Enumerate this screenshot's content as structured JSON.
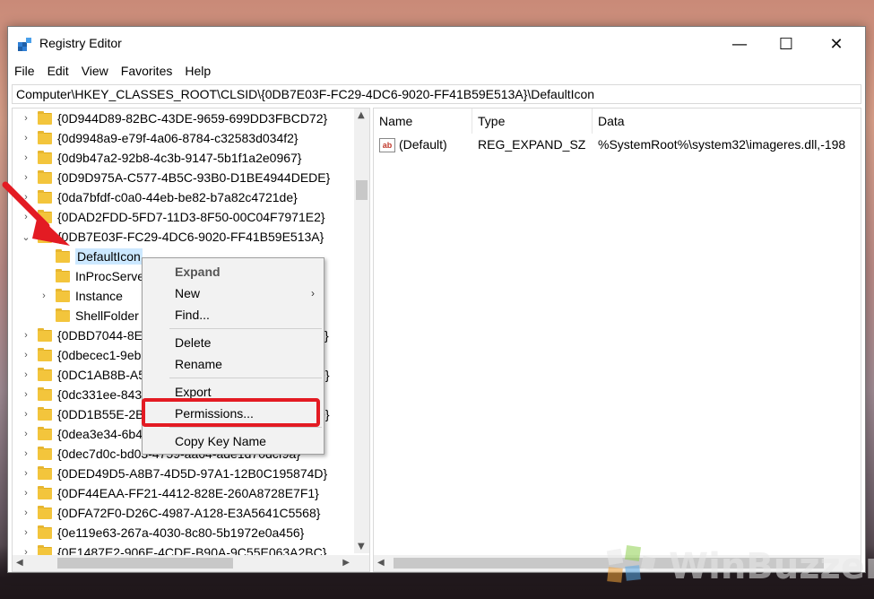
{
  "window": {
    "title": "Registry Editor",
    "controls": {
      "minimize": "—",
      "maximize": "☐",
      "close": "✕"
    }
  },
  "menu": [
    "File",
    "Edit",
    "View",
    "Favorites",
    "Help"
  ],
  "address": "Computer\\HKEY_CLASSES_ROOT\\CLSID\\{0DB7E03F-FC29-4DC6-9020-FF41B59E513A}\\DefaultIcon",
  "tree": [
    {
      "label": "{0D944D89-82BC-43DE-9659-699DD3FBCD72}",
      "level": 0,
      "expander": "›"
    },
    {
      "label": "{0d9948a9-e79f-4a06-8784-c32583d034f2}",
      "level": 0,
      "expander": "›"
    },
    {
      "label": "{0d9b47a2-92b8-4c3b-9147-5b1f1a2e0967}",
      "level": 0,
      "expander": "›"
    },
    {
      "label": "{0D9D975A-C577-4B5C-93B0-D1BE4944DEDE}",
      "level": 0,
      "expander": "›"
    },
    {
      "label": "{0da7bfdf-c0a0-44eb-be82-b7a82c4721de}",
      "level": 0,
      "expander": "›"
    },
    {
      "label": "{0DAD2FDD-5FD7-11D3-8F50-00C04F7971E2}",
      "level": 0,
      "expander": "›"
    },
    {
      "label": "{0DB7E03F-FC29-4DC6-9020-FF41B59E513A}",
      "level": 0,
      "expander": "⌄"
    },
    {
      "label": "DefaultIcon",
      "level": 1,
      "expander": "",
      "selected": true
    },
    {
      "label": "InProcServer32",
      "level": 1,
      "expander": ""
    },
    {
      "label": "Instance",
      "level": 1,
      "expander": "›"
    },
    {
      "label": "ShellFolder",
      "level": 1,
      "expander": ""
    },
    {
      "label": "{0DBD7044-8E0E-4F37-8E4C-9E7DBF4A2A7D}",
      "level": 0,
      "expander": "›"
    },
    {
      "label": "{0dbecec1-9eb3-4771-a7fd-cc7b0f6a1c0e}",
      "level": 0,
      "expander": "›"
    },
    {
      "label": "{0DC1AB8B-A5A1-4B14-8EA8-3C1F6A1D5B0F}",
      "level": 0,
      "expander": "›"
    },
    {
      "label": "{0dc331ee-8438-49c5-a721-e10b937ce459}",
      "level": 0,
      "expander": "›"
    },
    {
      "label": "{0DD1B55E-2B0C-4E44-8F2D-7A3F0E1C9A9D}",
      "level": 0,
      "expander": "›"
    },
    {
      "label": "{0dea3e34-6b4e-4a3b-9d6c-1f5b0e9a7c2e}",
      "level": 0,
      "expander": "›"
    },
    {
      "label": "{0dec7d0c-bd03-4759-aa64-ade1d70dcf9a}",
      "level": 0,
      "expander": "›"
    },
    {
      "label": "{0DED49D5-A8B7-4D5D-97A1-12B0C195874D}",
      "level": 0,
      "expander": "›"
    },
    {
      "label": "{0DF44EAA-FF21-4412-828E-260A8728E7F1}",
      "level": 0,
      "expander": "›"
    },
    {
      "label": "{0DFA72F0-D26C-4987-A128-E3A5641C5568}",
      "level": 0,
      "expander": "›"
    },
    {
      "label": "{0e119e63-267a-4030-8c80-5b1972e0a456}",
      "level": 0,
      "expander": "›"
    },
    {
      "label": "{0E1487E2-906E-4CDE-B90A-9C55E063A2BC}",
      "level": 0,
      "expander": "›"
    }
  ],
  "list": {
    "headers": {
      "name": "Name",
      "type": "Type",
      "data": "Data"
    },
    "rows": [
      {
        "icon": "ab",
        "name": "(Default)",
        "type": "REG_EXPAND_SZ",
        "data": "%SystemRoot%\\system32\\imageres.dll,-198"
      }
    ]
  },
  "context_menu": {
    "expand": "Expand",
    "new": "New",
    "find": "Find...",
    "delete": "Delete",
    "rename": "Rename",
    "export": "Export",
    "permissions": "Permissions...",
    "copy_key_name": "Copy Key Name"
  },
  "watermark": "WinBuzzer",
  "colors": {
    "highlight": "#e31b23",
    "selection": "#cce8ff",
    "folder": "#f3c53c"
  }
}
